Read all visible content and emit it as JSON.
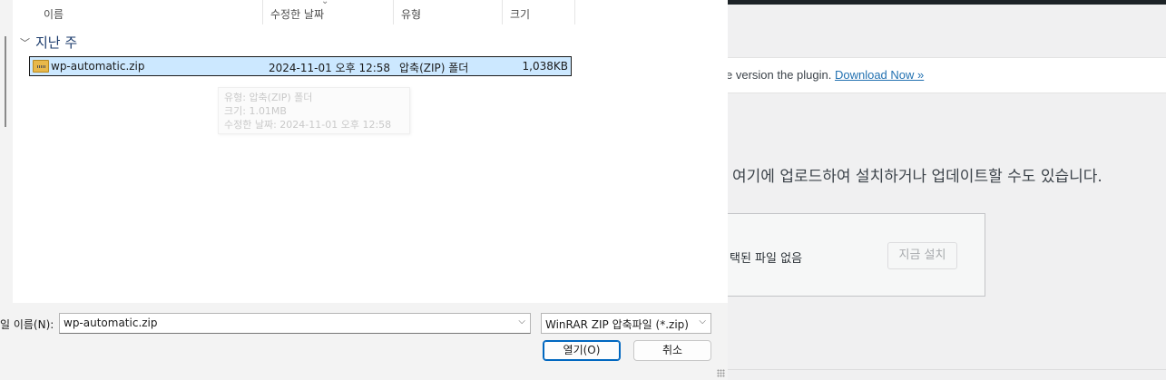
{
  "dialog": {
    "columns": {
      "name": "이름",
      "modified": "수정한 날짜",
      "type": "유형",
      "size": "크기"
    },
    "group": {
      "label": "지난 주"
    },
    "files": [
      {
        "name": "wp-automatic.zip",
        "modified": "2024-11-01 오후 12:58",
        "type": "압축(ZIP) 폴더",
        "size": "1,038KB",
        "icon": "zip-folder-icon"
      }
    ],
    "tooltip": {
      "type_line": "유형: 압축(ZIP) 폴더",
      "size_line": "크기: 1.01MB",
      "modified_line": "수정한 날짜: 2024-11-01 오후 12:58"
    },
    "filename_label": "일 이름(N):",
    "filename_value": "wp-automatic.zip",
    "filetype_value": "WinRAR ZIP 압축파일 (*.zip)",
    "open_button": "열기(O)",
    "cancel_button": "취소"
  },
  "background": {
    "notice_text": "e version the plugin. ",
    "notice_link": "Download Now »",
    "description": "여기에 업로드하여 설치하거나 업데이트할 수도 있습니다.",
    "no_file_text": "택된 파일 없음",
    "install_button": "지금 설치"
  }
}
